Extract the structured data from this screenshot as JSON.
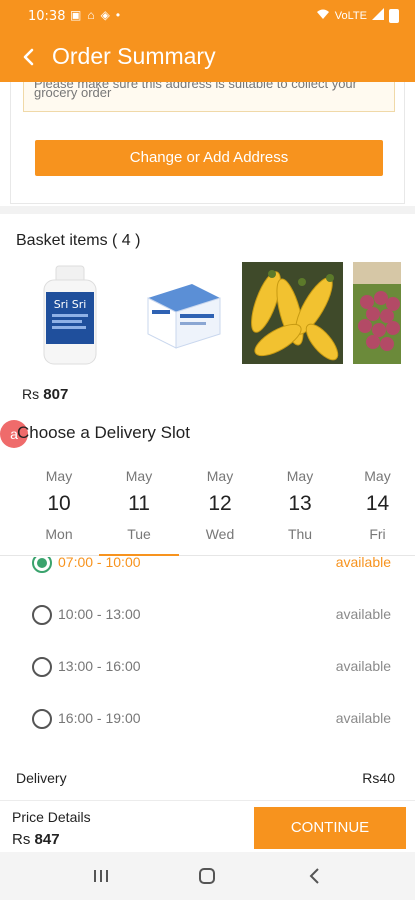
{
  "status_bar": {
    "time": "10:38",
    "network": "VoLTE"
  },
  "header": {
    "title": "Order Summary"
  },
  "address": {
    "note_line1": "Please make sure this address is suitable to collect your",
    "note_line2": "grocery order",
    "change_button": "Change or Add Address"
  },
  "basket": {
    "title": "Basket items ( 4 )",
    "items": [
      {
        "icon": "sri-sri-bottle-image",
        "brand": "Sri Sri"
      },
      {
        "icon": "medicine-box-image"
      },
      {
        "icon": "yellow-zucchini-image"
      },
      {
        "icon": "red-grapes-image"
      }
    ],
    "total_currency": "Rs",
    "total_value": "807"
  },
  "delivery_slot": {
    "badge": "a",
    "title": "Choose a Delivery Slot",
    "dates": [
      {
        "month": "May",
        "day": "10",
        "weekday": "Mon"
      },
      {
        "month": "May",
        "day": "11",
        "weekday": "Tue"
      },
      {
        "month": "May",
        "day": "12",
        "weekday": "Wed"
      },
      {
        "month": "May",
        "day": "13",
        "weekday": "Thu"
      },
      {
        "month": "May",
        "day": "14",
        "weekday": "Fri"
      }
    ],
    "selected_index": 1,
    "slots": [
      {
        "time": "07:00 - 10:00",
        "status": "available"
      },
      {
        "time": "10:00 - 13:00",
        "status": "available"
      },
      {
        "time": "13:00 - 16:00",
        "status": "available"
      },
      {
        "time": "16:00 - 19:00",
        "status": "available"
      }
    ]
  },
  "delivery_charge": {
    "label": "Delivery",
    "currency": "Rs",
    "value": "40"
  },
  "price_bar": {
    "label": "Price Details",
    "currency": "Rs",
    "value": "847",
    "continue_button": "CONTINUE"
  },
  "colors": {
    "accent": "#f7931e",
    "selected_radio": "#3aa36d",
    "badge": "#ef6b6b"
  }
}
